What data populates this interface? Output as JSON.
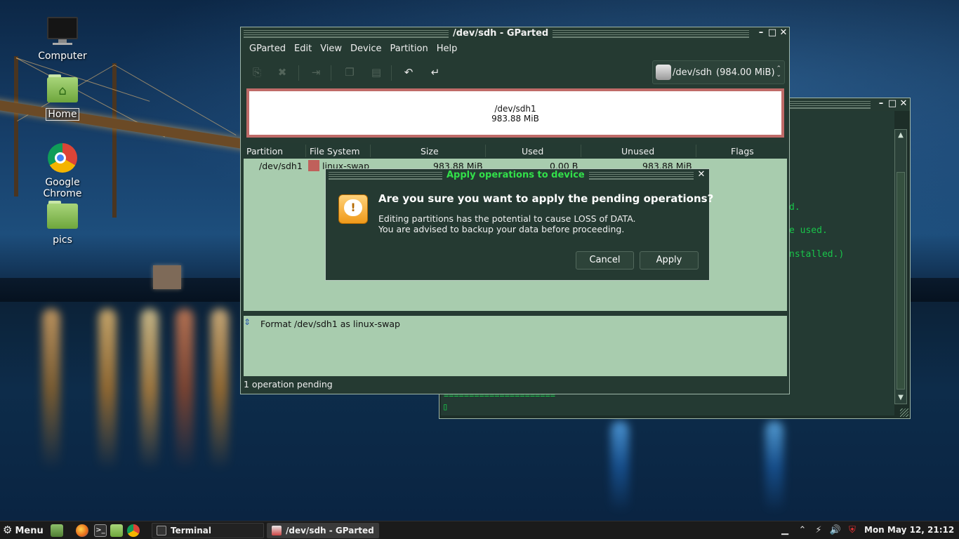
{
  "desktop": {
    "icons": [
      {
        "label": "Computer",
        "icon": "monitor-icon"
      },
      {
        "label": "Home",
        "icon": "home-folder-icon",
        "selected": true
      },
      {
        "label": "Google Chrome",
        "icon": "chrome-icon"
      },
      {
        "label": "pics",
        "icon": "folder-icon"
      }
    ]
  },
  "terminal": {
    "lines": [
      "d.",
      "e used.",
      "nstalled.)"
    ],
    "separator": "======================",
    "prompt_cursor": "▯"
  },
  "gparted": {
    "title": "/dev/sdh - GParted",
    "menu": [
      "GParted",
      "Edit",
      "View",
      "Device",
      "Partition",
      "Help"
    ],
    "toolbar": {
      "new": "new-partition-icon",
      "delete": "delete-icon",
      "resize": "resize-move-icon",
      "copy": "copy-icon",
      "paste": "paste-icon",
      "undo": "undo-icon",
      "apply": "apply-icon"
    },
    "device_selector": {
      "device": "/dev/sdh",
      "size": "(984.00 MiB)"
    },
    "graph": {
      "name": "/dev/sdh1",
      "size": "983.88 MiB",
      "color": "#c0605b"
    },
    "columns": [
      "Partition",
      "File System",
      "Size",
      "Used",
      "Unused",
      "Flags"
    ],
    "rows": [
      {
        "partition": "/dev/sdh1",
        "filesystem": "linux-swap",
        "size": "983.88 MiB",
        "used": "0.00 B",
        "unused": "983.88 MiB",
        "flags": ""
      }
    ],
    "operations": [
      "Format /dev/sdh1 as linux-swap"
    ],
    "status": "1 operation pending"
  },
  "dialog": {
    "title": "Apply operations to device",
    "heading": "Are you sure you want to apply the pending operations?",
    "message_line1": "Editing partitions has the potential to cause LOSS of DATA.",
    "message_line2": "You are advised to backup your data before proceeding.",
    "cancel": "Cancel",
    "apply": "Apply"
  },
  "taskbar": {
    "menu_label": "Menu",
    "launchers": [
      "show-desktop-icon",
      "firefox-icon",
      "terminal-icon",
      "files-icon",
      "chrome-icon"
    ],
    "tasks": [
      {
        "label": "Terminal",
        "active": false
      },
      {
        "label": "/dev/sdh - GParted",
        "active": true
      }
    ],
    "tray": [
      "workspace-icon",
      "chevron-up-icon",
      "network-icon",
      "volume-icon",
      "update-shield-icon"
    ],
    "clock": "Mon May 12, 21:12"
  }
}
